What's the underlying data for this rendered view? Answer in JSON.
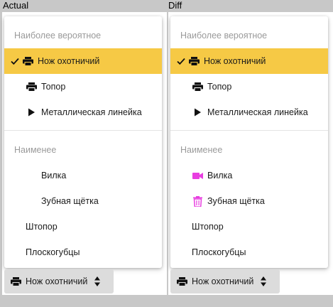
{
  "panels": [
    {
      "title": "Actual",
      "groups": {
        "likely": {
          "header": "Наиболее вероятное",
          "items": [
            {
              "label": "Нож охотничий",
              "icon": "printer-icon",
              "selected": true
            },
            {
              "label": "Топор",
              "icon": "printer-icon",
              "selected": false
            },
            {
              "label": "Металлическая линейка",
              "icon": "play-icon",
              "selected": false
            }
          ]
        },
        "unlikely": {
          "header": "Наименее",
          "items": [
            {
              "label": "Вилка",
              "icon": "none"
            },
            {
              "label": "Зубная щётка",
              "icon": "none"
            },
            {
              "label": "Штопор",
              "icon": "none"
            },
            {
              "label": "Плоскогубцы",
              "icon": "none"
            }
          ]
        }
      },
      "select_value": "Нож охотничий"
    },
    {
      "title": "Diff",
      "groups": {
        "likely": {
          "header": "Наиболее вероятное",
          "items": [
            {
              "label": "Нож охотничий",
              "icon": "printer-icon",
              "selected": true
            },
            {
              "label": "Топор",
              "icon": "printer-icon",
              "selected": false
            },
            {
              "label": "Металлическая линейка",
              "icon": "play-icon",
              "selected": false
            }
          ]
        },
        "unlikely": {
          "header": "Наименее",
          "items": [
            {
              "label": "Вилка",
              "icon": "videocam-icon"
            },
            {
              "label": "Зубная щётка",
              "icon": "trash-icon"
            },
            {
              "label": "Штопор",
              "icon": "none"
            },
            {
              "label": "Плоскогубцы",
              "icon": "none"
            }
          ]
        }
      },
      "select_value": "Нож охотничий"
    }
  ],
  "colors": {
    "selected_bg": "#f6c945",
    "diff_icon": "#e83ee0",
    "header_text": "#9a9a9a"
  }
}
